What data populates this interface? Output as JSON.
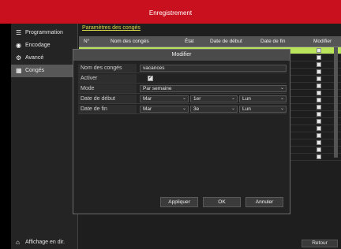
{
  "window": {
    "title": "Enregistrement"
  },
  "sidebar": {
    "items": [
      {
        "label": "Programmation",
        "icon": "list-icon"
      },
      {
        "label": "Encodage",
        "icon": "record-icon"
      },
      {
        "label": "Avancé",
        "icon": "gear-icon"
      },
      {
        "label": "Congés",
        "icon": "calendar-icon"
      }
    ],
    "bottom_label": "Affichage en dir."
  },
  "content": {
    "tab_title": "Paramètres des congés",
    "columns": [
      "N°",
      "Nom des congés",
      "État",
      "Date de début",
      "Date de fin",
      "Modifier"
    ],
    "return_label": "Retour"
  },
  "modal": {
    "title": "Modifier",
    "fields": {
      "name_label": "Nom des congés",
      "name_value": "vacances",
      "enable_label": "Activer",
      "mode_label": "Mode",
      "mode_value": "Par semaine",
      "start_label": "Date de début",
      "start_month": "Mar",
      "start_week": "1er",
      "start_day": "Lun",
      "end_label": "Date de fin",
      "end_month": "Mar",
      "end_week": "3e",
      "end_day": "Lun"
    },
    "buttons": {
      "apply": "Appliquer",
      "ok": "OK",
      "cancel": "Annuler"
    }
  }
}
